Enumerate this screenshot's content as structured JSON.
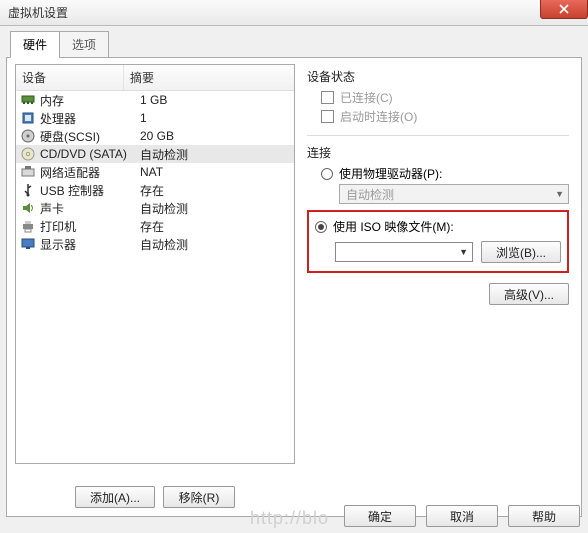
{
  "title": "虚拟机设置",
  "tabs": {
    "hardware": "硬件",
    "options": "选项"
  },
  "columns": {
    "device": "设备",
    "summary": "摘要"
  },
  "devices": [
    {
      "icon": "memory-icon",
      "name": "内存",
      "summary": "1 GB"
    },
    {
      "icon": "cpu-icon",
      "name": "处理器",
      "summary": "1"
    },
    {
      "icon": "disk-icon",
      "name": "硬盘(SCSI)",
      "summary": "20 GB"
    },
    {
      "icon": "cd-icon",
      "name": "CD/DVD (SATA)",
      "summary": "自动检测",
      "selected": true
    },
    {
      "icon": "nic-icon",
      "name": "网络适配器",
      "summary": "NAT"
    },
    {
      "icon": "usb-icon",
      "name": "USB 控制器",
      "summary": "存在"
    },
    {
      "icon": "sound-icon",
      "name": "声卡",
      "summary": "自动检测"
    },
    {
      "icon": "printer-icon",
      "name": "打印机",
      "summary": "存在"
    },
    {
      "icon": "display-icon",
      "name": "显示器",
      "summary": "自动检测"
    }
  ],
  "buttons": {
    "add": "添加(A)...",
    "remove": "移除(R)",
    "browse": "浏览(B)...",
    "advanced": "高级(V)...",
    "ok": "确定",
    "cancel": "取消",
    "help": "帮助"
  },
  "right": {
    "status_label": "设备状态",
    "connected": "已连接(C)",
    "connect_at_power": "启动时连接(O)",
    "connection_label": "连接",
    "use_physical": "使用物理驱动器(P):",
    "auto_detect": "自动检测",
    "use_iso": "使用 ISO 映像文件(M):"
  },
  "watermark": "http://blo"
}
